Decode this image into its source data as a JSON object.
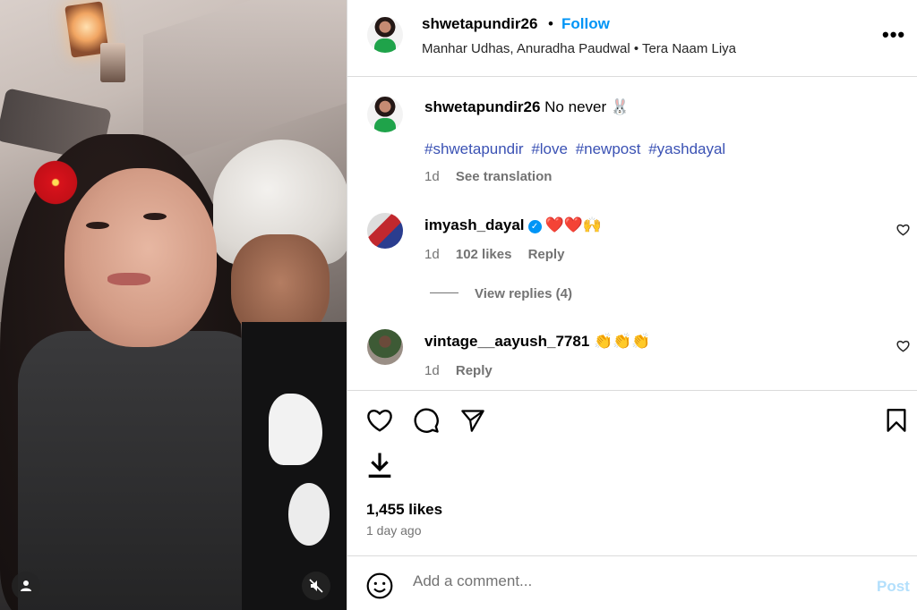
{
  "post": {
    "username": "shwetapundir26",
    "dot": "•",
    "follow_label": "Follow",
    "audio": "Manhar Udhas, Anuradha Paudwal • Tera Naam Liya",
    "more_icon": "•••"
  },
  "caption": {
    "username": "shwetapundir26",
    "text": "No never 🐰",
    "hashtags": [
      "#shwetapundir",
      "#love",
      "#newpost",
      "#yashdayal"
    ],
    "time": "1d",
    "see_translation": "See translation"
  },
  "comments": [
    {
      "username": "imyash_dayal",
      "text": "❤️❤️🙌",
      "time": "1d",
      "likes": "102 likes",
      "reply": "Reply",
      "verified": true
    },
    {
      "username": "vintage__aayush_7781",
      "text": "👏👏👏",
      "time": "1d",
      "reply": "Reply"
    }
  ],
  "view_replies": "View replies (4)",
  "stats": {
    "likes": "1,455 likes",
    "posted": "1 day ago"
  },
  "comment_box": {
    "placeholder": "Add a comment...",
    "post_label": "Post"
  },
  "colors": {
    "accent": "#0095f6",
    "hashtag": "#3b52b4",
    "muted": "#737373",
    "border": "#dbdbdb"
  }
}
